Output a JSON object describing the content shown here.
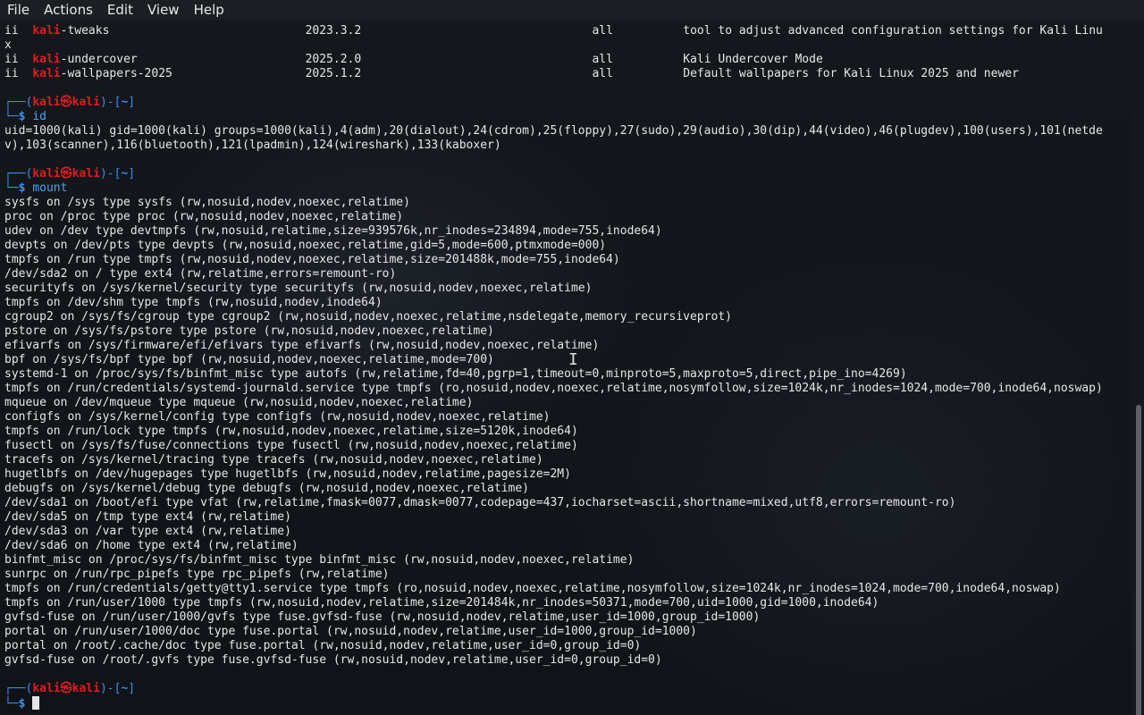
{
  "menubar": {
    "file": "File",
    "actions": "Actions",
    "edit": "Edit",
    "view": "View",
    "help": "Help"
  },
  "packages": [
    {
      "status": "ii",
      "name_highlight": "kali",
      "name_rest": "-tweaks",
      "version": "2023.3.2",
      "arch": "all",
      "description": "tool to adjust advanced configuration settings for Kali Linu",
      "wrap": "x"
    },
    {
      "status": "ii",
      "name_highlight": "kali",
      "name_rest": "-undercover",
      "version": "2025.2.0",
      "arch": "all",
      "description": "Kali Undercover Mode"
    },
    {
      "status": "ii",
      "name_highlight": "kali",
      "name_rest": "-wallpapers-2025",
      "version": "2025.1.2",
      "arch": "all",
      "description": "Default wallpapers for Kali Linux 2025 and newer"
    }
  ],
  "prompt": {
    "user": "kali",
    "host": "kali",
    "at": "㉿",
    "dir": "~",
    "symbol": "$"
  },
  "commands": {
    "id": "id",
    "mount": "mount"
  },
  "id_output": [
    "uid=1000(kali) gid=1000(kali) groups=1000(kali),4(adm),20(dialout),24(cdrom),25(floppy),27(sudo),29(audio),30(dip),44(video),46(plugdev),100(users),101(netde",
    "v),103(scanner),116(bluetooth),121(lpadmin),124(wireshark),133(kaboxer)"
  ],
  "mount_output": [
    "sysfs on /sys type sysfs (rw,nosuid,nodev,noexec,relatime)",
    "proc on /proc type proc (rw,nosuid,nodev,noexec,relatime)",
    "udev on /dev type devtmpfs (rw,nosuid,relatime,size=939576k,nr_inodes=234894,mode=755,inode64)",
    "devpts on /dev/pts type devpts (rw,nosuid,noexec,relatime,gid=5,mode=600,ptmxmode=000)",
    "tmpfs on /run type tmpfs (rw,nosuid,nodev,noexec,relatime,size=201488k,mode=755,inode64)",
    "/dev/sda2 on / type ext4 (rw,relatime,errors=remount-ro)",
    "securityfs on /sys/kernel/security type securityfs (rw,nosuid,nodev,noexec,relatime)",
    "tmpfs on /dev/shm type tmpfs (rw,nosuid,nodev,inode64)",
    "cgroup2 on /sys/fs/cgroup type cgroup2 (rw,nosuid,nodev,noexec,relatime,nsdelegate,memory_recursiveprot)",
    "pstore on /sys/fs/pstore type pstore (rw,nosuid,nodev,noexec,relatime)",
    "efivarfs on /sys/firmware/efi/efivars type efivarfs (rw,nosuid,nodev,noexec,relatime)",
    "bpf on /sys/fs/bpf type bpf (rw,nosuid,nodev,noexec,relatime,mode=700)",
    "systemd-1 on /proc/sys/fs/binfmt_misc type autofs (rw,relatime,fd=40,pgrp=1,timeout=0,minproto=5,maxproto=5,direct,pipe_ino=4269)",
    "tmpfs on /run/credentials/systemd-journald.service type tmpfs (ro,nosuid,nodev,noexec,relatime,nosymfollow,size=1024k,nr_inodes=1024,mode=700,inode64,noswap)",
    "mqueue on /dev/mqueue type mqueue (rw,nosuid,nodev,noexec,relatime)",
    "configfs on /sys/kernel/config type configfs (rw,nosuid,nodev,noexec,relatime)",
    "tmpfs on /run/lock type tmpfs (rw,nosuid,nodev,noexec,relatime,size=5120k,inode64)",
    "fusectl on /sys/fs/fuse/connections type fusectl (rw,nosuid,nodev,noexec,relatime)",
    "tracefs on /sys/kernel/tracing type tracefs (rw,nosuid,nodev,noexec,relatime)",
    "hugetlbfs on /dev/hugepages type hugetlbfs (rw,nosuid,nodev,relatime,pagesize=2M)",
    "debugfs on /sys/kernel/debug type debugfs (rw,nosuid,nodev,noexec,relatime)",
    "/dev/sda1 on /boot/efi type vfat (rw,relatime,fmask=0077,dmask=0077,codepage=437,iocharset=ascii,shortname=mixed,utf8,errors=remount-ro)",
    "/dev/sda5 on /tmp type ext4 (rw,relatime)",
    "/dev/sda3 on /var type ext4 (rw,relatime)",
    "/dev/sda6 on /home type ext4 (rw,relatime)",
    "binfmt_misc on /proc/sys/fs/binfmt_misc type binfmt_misc (rw,nosuid,nodev,noexec,relatime)",
    "sunrpc on /run/rpc_pipefs type rpc_pipefs (rw,relatime)",
    "tmpfs on /run/credentials/getty@tty1.service type tmpfs (ro,nosuid,nodev,noexec,relatime,nosymfollow,size=1024k,nr_inodes=1024,mode=700,inode64,noswap)",
    "tmpfs on /run/user/1000 type tmpfs (rw,nosuid,nodev,relatime,size=201484k,nr_inodes=50371,mode=700,uid=1000,gid=1000,inode64)",
    "gvfsd-fuse on /run/user/1000/gvfs type fuse.gvfsd-fuse (rw,nosuid,nodev,relatime,user_id=1000,group_id=1000)",
    "portal on /run/user/1000/doc type fuse.portal (rw,nosuid,nodev,relatime,user_id=1000,group_id=1000)",
    "portal on /root/.cache/doc type fuse.portal (rw,nosuid,nodev,relatime,user_id=0,group_id=0)",
    "gvfsd-fuse on /root/.gvfs type fuse.gvfsd-fuse (rw,nosuid,nodev,relatime,user_id=0,group_id=0)"
  ],
  "colors": {
    "prompt_frame": "#3b8eea",
    "prompt_user": "#e01b24",
    "text": "#e6e6e6",
    "background": "#111418"
  }
}
